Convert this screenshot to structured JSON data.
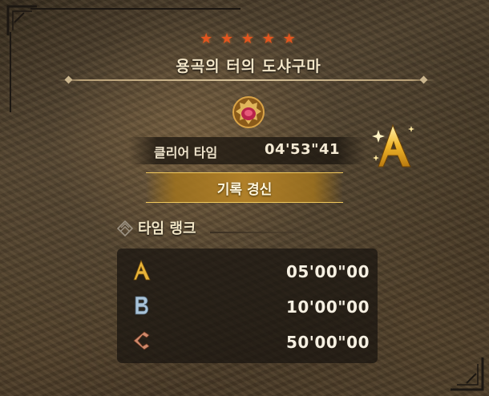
{
  "quest": {
    "stars": [
      "★",
      "★",
      "★",
      "★",
      "★"
    ],
    "title": "용곡의 터의 도샤구마",
    "star_color": "#e2551f"
  },
  "clear": {
    "label": "클리어 타임",
    "time": "04'53\"41",
    "rank": "A"
  },
  "record": {
    "label": "기록 경신"
  },
  "time_rank": {
    "title": "타임 랭크",
    "rows": [
      {
        "rank": "A",
        "time": "05'00\"00",
        "color": "#e8b43a"
      },
      {
        "rank": "B",
        "time": "10'00\"00",
        "color": "#a9c3d8"
      },
      {
        "rank": "C",
        "time": "50'00\"00",
        "color": "#d08a6c"
      }
    ]
  },
  "icons": {
    "emblem": "monster-emblem-icon",
    "section": "time-rank-icon"
  }
}
